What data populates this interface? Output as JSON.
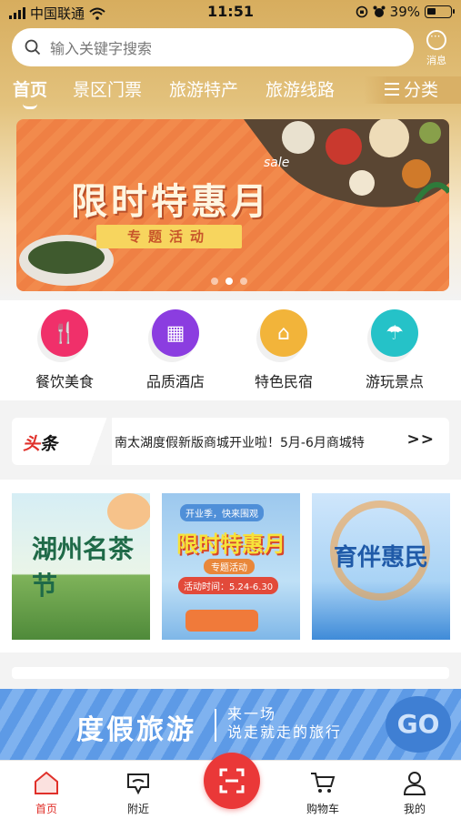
{
  "status_bar": {
    "carrier": "中国联通",
    "time": "11:51",
    "battery": "39%",
    "battery_level": 0.39
  },
  "search": {
    "placeholder": "输入关键字搜索"
  },
  "message": {
    "label": "消息"
  },
  "tabs": [
    {
      "label": "首页",
      "active": true
    },
    {
      "label": "景区门票"
    },
    {
      "label": "旅游特产"
    },
    {
      "label": "旅游线路"
    }
  ],
  "category": {
    "label": "分类"
  },
  "banner": {
    "title": "限时特惠月",
    "subtitle": "专题活动",
    "tag": "sale",
    "slide_count": 3,
    "active_slide": 2
  },
  "quick_links": [
    {
      "label": "餐饮美食",
      "icon": "fork-knife-icon",
      "color": "#f0306a"
    },
    {
      "label": "品质酒店",
      "icon": "hotel-icon",
      "color": "#8b3de0"
    },
    {
      "label": "特色民宿",
      "icon": "house-icon",
      "color": "#f2b43a"
    },
    {
      "label": "游玩景点",
      "icon": "umbrella-icon",
      "color": "#25c2c8"
    }
  ],
  "news": {
    "logo_red": "头",
    "logo_black": "条",
    "text": "南太湖度假新版商城开业啦！5月-6月商城特",
    "more": ">>"
  },
  "promos": [
    {
      "title": "湖州名茶节"
    },
    {
      "title": "限时特惠月",
      "top": "开业季，快来围观",
      "sub": "专题活动",
      "time": "活动时间：5.24-6.30"
    },
    {
      "title": "育伴惠民"
    }
  ],
  "travel_banner": {
    "title": "度假旅游",
    "line1": "来一场",
    "line2": "说走就走的旅行",
    "badge": "GO"
  },
  "bottom_nav": [
    {
      "label": "首页",
      "active": true
    },
    {
      "label": "附近"
    },
    {
      "label": "购物车"
    },
    {
      "label": "我的"
    }
  ],
  "colors": {
    "accent": "#e0302a",
    "header": "#d7ad5e"
  }
}
